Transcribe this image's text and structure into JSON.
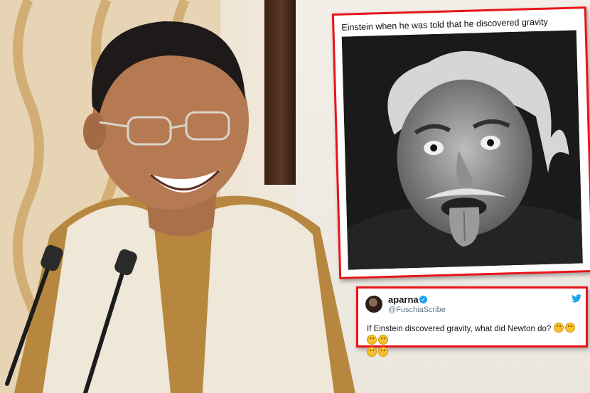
{
  "tweet_card": {
    "caption": "Einstein when he was told that he discovered gravity"
  },
  "reply_card": {
    "name": "aparna",
    "handle": "@FuschiaScribe",
    "text": "If Einstein discovered gravity, what did Newton do?",
    "emoji_count": 6,
    "emoji": "thinking-face"
  },
  "colors": {
    "highlight_border": "#e8141a",
    "twitter_blue": "#1da1f2"
  }
}
